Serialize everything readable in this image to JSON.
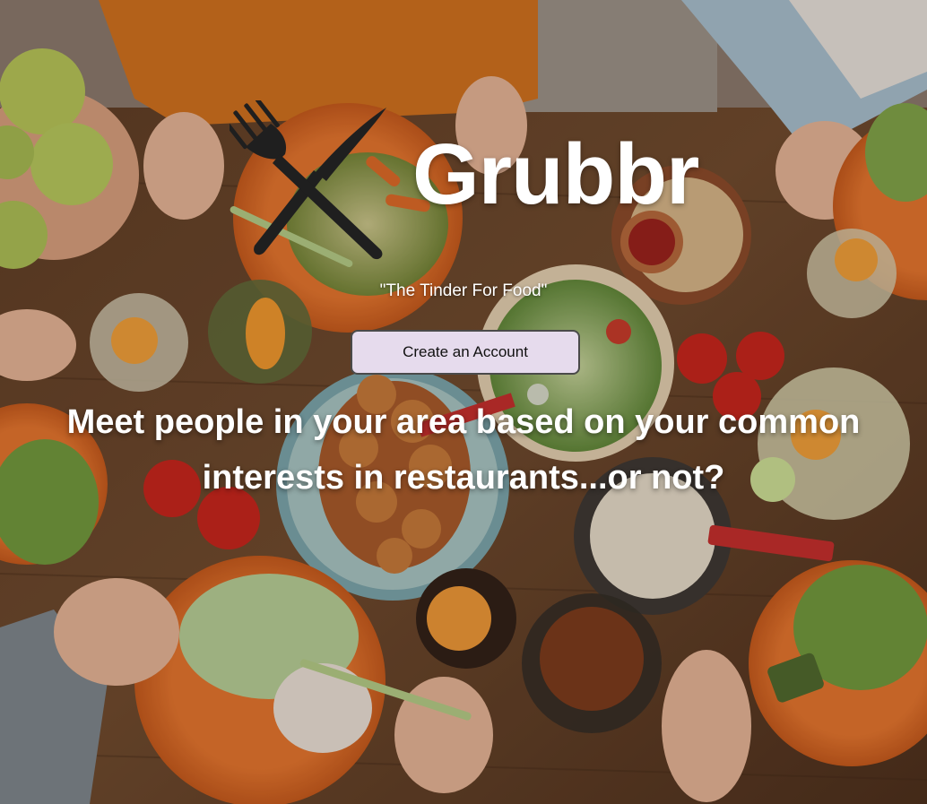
{
  "brand": {
    "title": "Grubbr",
    "tagline": "\"The Tinder For Food\"",
    "logo_icon": "fork-knife-crossed-icon"
  },
  "cta": {
    "create_account_label": "Create an Account"
  },
  "hero": {
    "headline": "Meet people in your area based on your common interests in restaurants...or not?",
    "background_image": "overhead-dinner-table-photo"
  },
  "colors": {
    "button_bg": "#e6dbed",
    "button_border": "#4a4a4a",
    "text": "#ffffff",
    "logo": "#1f1f1f"
  }
}
